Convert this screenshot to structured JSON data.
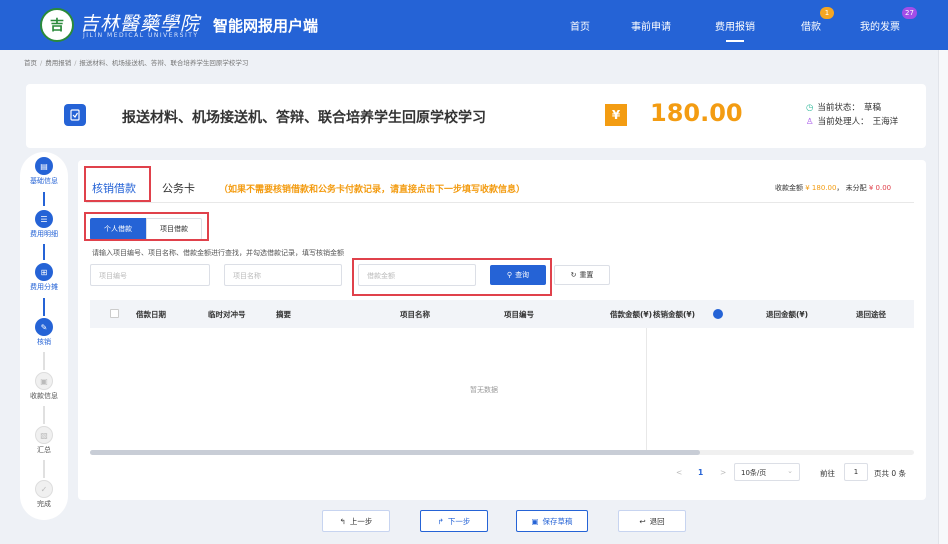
{
  "header": {
    "logo_text": "吉",
    "brand_cn": "吉林醫藥學院",
    "brand_en": "JILIN MEDICAL UNIVERSITY",
    "app_name": "智能网报用户端",
    "nav": [
      {
        "label": "首页"
      },
      {
        "label": "事前申请"
      },
      {
        "label": "费用报销"
      },
      {
        "label": "借款",
        "badge": "1"
      },
      {
        "label": "我的发票",
        "badge": "27"
      }
    ]
  },
  "breadcrumb": [
    "首页",
    "费用报销",
    "报送材料、机场接送机、答辩、联合培养学生回原学校学习"
  ],
  "summary": {
    "title": "报送材料、机场接送机、答辩、联合培养学生回原学校学习",
    "amount": "180.00",
    "status_label": "当前状态：",
    "status_value": "草稿",
    "handler_label": "当前处理人：",
    "handler_value": "王海洋"
  },
  "steps": [
    {
      "label": "基础信息",
      "state": "done",
      "icon": "doc-icon"
    },
    {
      "label": "费用明细",
      "state": "done",
      "icon": "list-icon"
    },
    {
      "label": "费用分摊",
      "state": "done",
      "icon": "split-icon"
    },
    {
      "label": "核销",
      "state": "done",
      "icon": "writeoff-icon"
    },
    {
      "label": "收款信息",
      "state": "todo",
      "icon": "payee-icon"
    },
    {
      "label": "汇总",
      "state": "todo",
      "icon": "summary-icon"
    },
    {
      "label": "完成",
      "state": "todo",
      "icon": "check-icon"
    }
  ],
  "tabs": {
    "writeoff": "核销借款",
    "card": "公务卡",
    "hint": "（如果不需要核销借款和公务卡付款记录，请直接点击下一步填写收款信息）"
  },
  "collect": {
    "label": "收款金额",
    "amount": "¥ 180.00",
    "unalloc_label": "未分配",
    "unalloc_amount": "¥ 0.00"
  },
  "loan_type": {
    "personal": "个人借款",
    "project": "项目借款"
  },
  "search": {
    "description": "请输入项目编号、项目名称、借款金额进行查找，并勾选借款记录，填写核销金额",
    "project_no_placeholder": "项目编号",
    "project_name_placeholder": "项目名称",
    "amount_placeholder": "借款金额",
    "search_label": "查询",
    "reset_label": "重置"
  },
  "table": {
    "columns": [
      "借款日期",
      "临时对冲号",
      "摘要",
      "项目名称",
      "项目编号",
      "借款金额(¥)",
      "核销金额(¥)",
      "退回金额(¥)",
      "退回途径"
    ],
    "empty_text": "暂无数据"
  },
  "pagination": {
    "prev": "<",
    "page": "1",
    "next": ">",
    "page_size": "10条/页",
    "goto_label": "前往",
    "goto_value": "1",
    "total_label": "页共 0 条"
  },
  "footer": {
    "prev": "上一步",
    "next": "下一步",
    "save": "保存草稿",
    "back": "退回"
  },
  "colors": {
    "primary": "#2563d6",
    "amount": "#f39c12",
    "highlight": "#e0414b"
  }
}
